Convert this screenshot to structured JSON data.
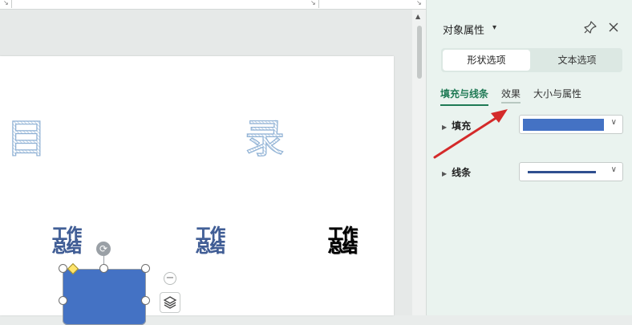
{
  "ruler": {
    "marks": [
      "↘",
      "↘",
      "↘"
    ]
  },
  "document": {
    "title_chars": [
      "目",
      "录"
    ],
    "wordart": [
      {
        "line1": "工作",
        "line2": "总结",
        "style": "blue"
      },
      {
        "line1": "工作",
        "line2": "总结",
        "style": "blue"
      },
      {
        "line1": "工作",
        "line2": "总结",
        "style": "dark"
      }
    ],
    "shape_color": "#4472c4",
    "rotate_glyph": "⟳",
    "minus_glyph": "−"
  },
  "scrollbar": {
    "up_glyph": "▲"
  },
  "panel": {
    "title": "对象属性",
    "title_caret": "▾",
    "pin_icon": "pin-icon",
    "close_icon": "close-icon",
    "segments": [
      "形状选项",
      "文本选项"
    ],
    "active_segment": "形状选项",
    "tabs": [
      "填充与线条",
      "效果",
      "大小与属性"
    ],
    "active_tab": "填充与线条",
    "sections": [
      {
        "caret": "▶",
        "label": "填充",
        "swatch_color": "#4472c4",
        "chevron": "∨"
      },
      {
        "caret": "▶",
        "label": "线条",
        "swatch_color": "#2f4f8f",
        "chevron": "∨"
      }
    ]
  },
  "colors": {
    "accent": "#1f7a55",
    "panel_bg": "#eaf3ef",
    "annotation_arrow": "#d42a2a"
  }
}
